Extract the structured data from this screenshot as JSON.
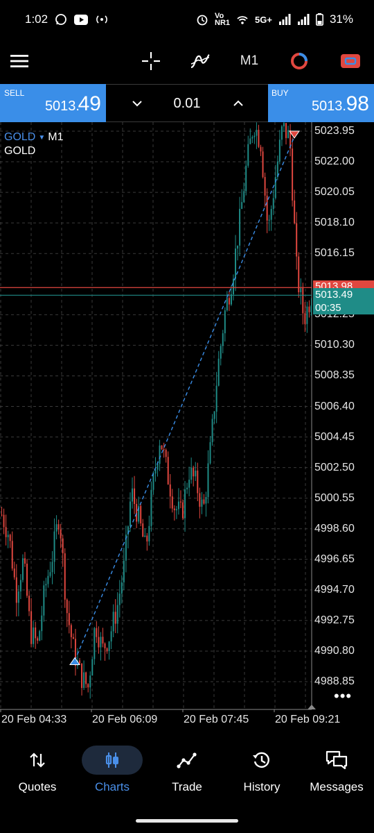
{
  "status_bar": {
    "time": "1:02",
    "network": "5G+",
    "battery": "31%",
    "carrier_tag": "Vo\nNR1"
  },
  "toolbar": {
    "timeframe": "M1",
    "icons": [
      "menu-icon",
      "crosshair-icon",
      "indicators-icon",
      "timeframe",
      "chart-type-icon",
      "trade-icon"
    ]
  },
  "trade": {
    "sell_label": "SELL",
    "sell_price_main": "5013.",
    "sell_price_big": "49",
    "buy_label": "BUY",
    "buy_price_main": "5013.",
    "buy_price_big": "98",
    "lot": "0.01"
  },
  "chart": {
    "symbol": "GOLD",
    "timeframe": "M1",
    "description": "GOLD",
    "ask_tag": "5013.98",
    "bid_tag": "5013.49",
    "countdown": "00:35",
    "colors": {
      "bull": "#1f8c87",
      "bear": "#e0473f",
      "grid": "#3a3a3a",
      "accent": "#3a8ee8"
    }
  },
  "chart_data": {
    "type": "candlestick",
    "symbol": "GOLD",
    "timeframe": "M1",
    "y_ticks": [
      "5023.95",
      "5022.00",
      "5020.05",
      "5018.10",
      "5016.15",
      "5012.25",
      "5010.30",
      "5008.35",
      "5006.40",
      "5004.45",
      "5002.50",
      "5000.55",
      "4998.60",
      "4996.65",
      "4994.70",
      "4992.75",
      "4990.80",
      "4988.85"
    ],
    "ylim": [
      4987.0,
      5024.5
    ],
    "x_ticks": [
      "20 Feb 04:33",
      "20 Feb 06:09",
      "20 Feb 07:45",
      "20 Feb 09:21"
    ],
    "ask": 5013.98,
    "bid": 5013.49,
    "trade_line": {
      "open_price": 4990.2,
      "close_price": 5023.6,
      "style": "dashed",
      "color": "#3a8ee8"
    },
    "grid": true,
    "close_path": [
      4999.5,
      4998.2,
      4994.5,
      4996.6,
      4992.0,
      4991.2,
      4994.8,
      4996.8,
      4999.6,
      4993.5,
      4990.8,
      4989.2,
      4988.5,
      4992.6,
      4990.9,
      4991.8,
      4993.5,
      4996.2,
      5001.0,
      4999.3,
      4997.2,
      5001.4,
      5004.5,
      5002.1,
      5000.0,
      4999.5,
      5002.3,
      5001.5,
      4999.7,
      5003.7,
      5008.8,
      5012.4,
      5014.6,
      5018.0,
      5021.8,
      5024.5,
      5023.2,
      5017.5,
      5021.0,
      5024.2,
      5023.5,
      5014.8,
      5012.0,
      5013.5
    ]
  },
  "nav": {
    "items": [
      {
        "label": "Quotes",
        "icon": "quotes-icon",
        "active": false
      },
      {
        "label": "Charts",
        "icon": "charts-icon",
        "active": true
      },
      {
        "label": "Trade",
        "icon": "trade-nav-icon",
        "active": false
      },
      {
        "label": "History",
        "icon": "history-icon",
        "active": false
      },
      {
        "label": "Messages",
        "icon": "messages-icon",
        "active": false
      }
    ]
  }
}
